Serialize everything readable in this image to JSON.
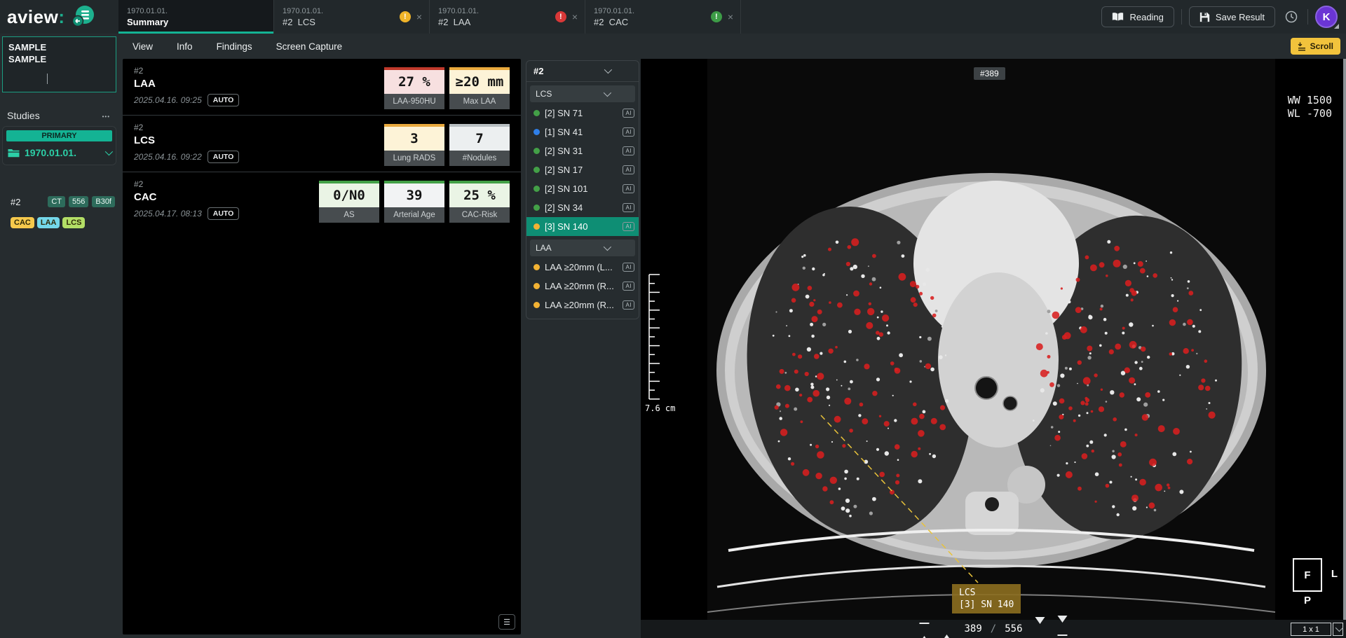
{
  "app": {
    "logo_text": "aview",
    "logo_colon": ":"
  },
  "topbar": {
    "tabs": [
      {
        "date": "1970.01.01.",
        "label": "Summary"
      },
      {
        "date": "1970.01.01.",
        "label": "#2  LCS",
        "status_color": "#f0b429"
      },
      {
        "date": "1970.01.01.",
        "label": "#2  LAA",
        "status_color": "#d93838"
      },
      {
        "date": "1970.01.01.",
        "label": "#2  CAC",
        "status_color": "#3d9c47"
      }
    ],
    "reading_label": "Reading",
    "save_label": "Save Result",
    "avatar_initial": "K"
  },
  "sidebar": {
    "patient_line1": "SAMPLE",
    "patient_line2": "SAMPLE",
    "studies_title": "Studies",
    "primary_badge": "PRIMARY",
    "study_date": "1970.01.01.",
    "series_id": "#2",
    "series_badges": {
      "modality": "CT",
      "count": "556",
      "kernel": "B30f"
    },
    "modality_badges": [
      {
        "label": "CAC",
        "color": "#f5c84c"
      },
      {
        "label": "LAA",
        "color": "#74d7ea"
      },
      {
        "label": "LCS",
        "color": "#b3de66"
      }
    ]
  },
  "menubar": {
    "items": {
      "view": "View",
      "info": "Info",
      "findings": "Findings",
      "capture": "Screen Capture"
    },
    "scroll_label": "Scroll"
  },
  "summary": {
    "cards": [
      {
        "series": "#2",
        "name": "LAA",
        "datetime": "2025.04.16. 09:25",
        "mode": "AUTO",
        "metrics": [
          {
            "value": "27 %",
            "label": "LAA-950HU",
            "bg": "#f7e0e0",
            "top": "#c0392b"
          },
          {
            "value": "≥20 mm",
            "label": "Max LAA",
            "bg": "#fdf3d7",
            "top": "#e9a93d"
          }
        ]
      },
      {
        "series": "#2",
        "name": "LCS",
        "datetime": "2025.04.16. 09:22",
        "mode": "AUTO",
        "metrics": [
          {
            "value": "3",
            "label": "Lung RADS",
            "bg": "#fdf3d7",
            "top": "#e9a93d"
          },
          {
            "value": "7",
            "label": "#Nodules",
            "bg": "#eceff0",
            "top": "#b8bfc2"
          }
        ]
      },
      {
        "series": "#2",
        "name": "CAC",
        "datetime": "2025.04.17. 08:13",
        "mode": "AUTO",
        "metrics": [
          {
            "value": "0/N0",
            "label": "AS",
            "bg": "#eaf4e5",
            "top": "#43a047"
          },
          {
            "value": "39",
            "label": "Arterial Age",
            "bg": "#f2f3f4",
            "top": "#43a047"
          },
          {
            "value": "25 %",
            "label": "CAC-Risk",
            "bg": "#eaf4e5",
            "top": "#43a047"
          }
        ]
      }
    ]
  },
  "findings": {
    "series_selector": "#2",
    "ai_label": "AI",
    "groups": [
      {
        "name": "LCS",
        "items": [
          {
            "dot": "#43a047",
            "label": "[2] SN 71"
          },
          {
            "dot": "#2f7fe8",
            "label": "[1] SN 41"
          },
          {
            "dot": "#43a047",
            "label": "[2] SN 31"
          },
          {
            "dot": "#43a047",
            "label": "[2] SN 17"
          },
          {
            "dot": "#43a047",
            "label": "[2] SN 101"
          },
          {
            "dot": "#43a047",
            "label": "[2] SN 34"
          },
          {
            "dot": "#f2b233",
            "label": "[3] SN 140",
            "selected": true
          }
        ]
      },
      {
        "name": "LAA",
        "items": [
          {
            "dot": "#f2b233",
            "label": "LAA ≥20mm (L..."
          },
          {
            "dot": "#f2b233",
            "label": "LAA ≥20mm (R..."
          },
          {
            "dot": "#f2b233",
            "label": "LAA ≥20mm (R..."
          }
        ]
      }
    ]
  },
  "viewer": {
    "slice_badge": "#389",
    "window_width": "WW 1500",
    "window_level": "WL -700",
    "ruler_label": "7.6 cm",
    "annotation": {
      "line1": "LCS",
      "line2": "[3] SN 140"
    },
    "orientation": {
      "front": "F",
      "left": "L",
      "posterior": "P"
    },
    "nav": {
      "current": "389",
      "separator": "/",
      "total": "556"
    },
    "layout_label": "1 x 1",
    "accent_colors": {
      "selection_teal": "#0e8e74",
      "annotation_olive": "#8a6c20",
      "dashed_line": "#e8c23a"
    }
  }
}
